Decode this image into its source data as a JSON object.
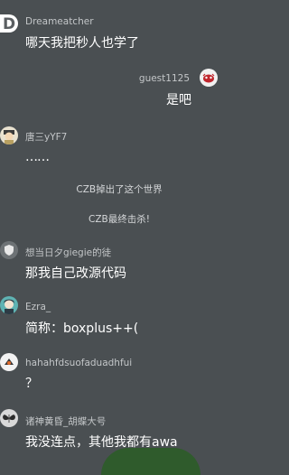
{
  "messages": [
    {
      "user": "Dreameatcher",
      "text": "哪天我把秒人也学了",
      "avatar_icon": "letter-d-avatar-icon"
    },
    {
      "user": "guest1125",
      "text": "是吧",
      "avatar_icon": "red-creature-avatar-icon"
    },
    {
      "user": "唐三yYF7",
      "text": "……",
      "avatar_icon": "tang-san-avatar-icon"
    }
  ],
  "system_messages": [
    "CZB掉出了这个世界",
    "CZB最终击杀!"
  ],
  "messages2": [
    {
      "user": "想当日夕giegie的徒",
      "text": "那我自己改源代码",
      "avatar_icon": "shield-avatar-icon"
    },
    {
      "user": "Ezra_",
      "text": "简称：boxplus++(",
      "avatar_icon": "anime-avatar-icon"
    },
    {
      "user": "hahahfdsuofaduadhfui",
      "text": "？",
      "avatar_icon": "fox-avatar-icon"
    },
    {
      "user": "诸神黄昏_胡蝶大号",
      "text": "我没连点，其他我都有awa",
      "avatar_icon": "butterfly-avatar-icon"
    }
  ],
  "colors": {
    "background": "#4a4f52",
    "username": "#c3c6c8",
    "message_text": "#ffffff",
    "system_text": "#d6d8da"
  }
}
